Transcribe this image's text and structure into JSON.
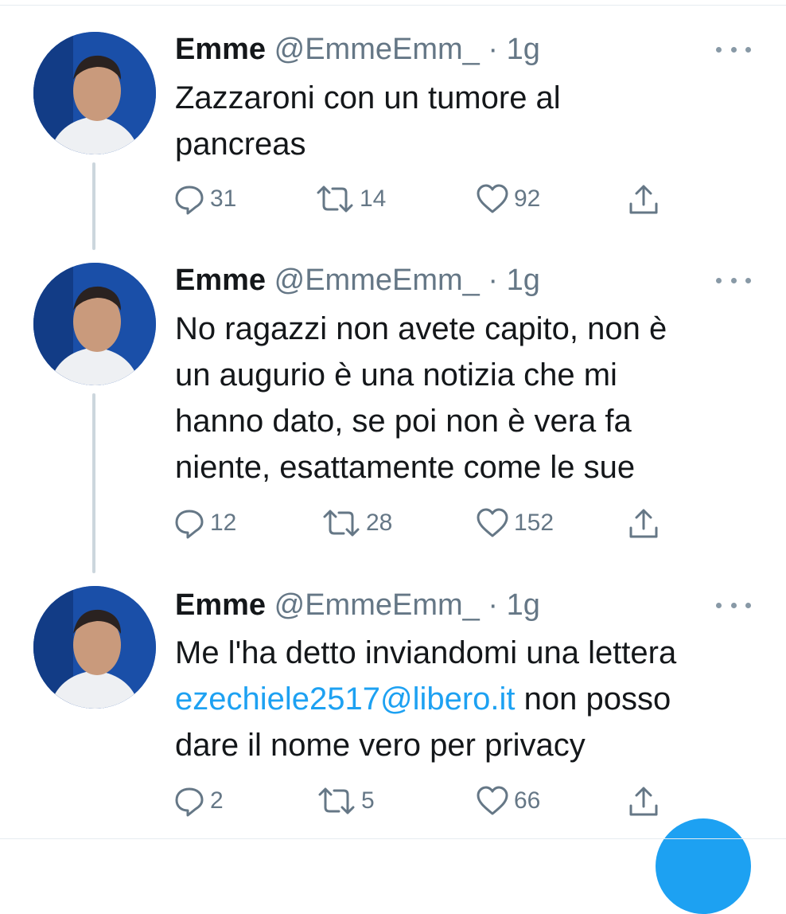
{
  "tweets": [
    {
      "name": "Emme",
      "handle": "@EmmeEmm_",
      "separator": "·",
      "time": "1g",
      "text_lines": [
        "Zazzaroni con un tumore al",
        "pancreas"
      ],
      "replies": "31",
      "retweets": "14",
      "likes": "92"
    },
    {
      "name": "Emme",
      "handle": "@EmmeEmm_",
      "separator": "·",
      "time": "1g",
      "text_lines": [
        "No ragazzi non avete capito, non è",
        "un augurio è una notizia che mi",
        "hanno dato, se poi non è vera fa",
        "niente, esattamente come le sue"
      ],
      "replies": "12",
      "retweets": "28",
      "likes": "152"
    },
    {
      "name": "Emme",
      "handle": "@EmmeEmm_",
      "separator": "·",
      "time": "1g",
      "text_line1": "Me l'ha detto inviandomi una lettera",
      "text_link": "ezechiele2517@libero.it",
      "text_line2_rest": " non posso",
      "text_line3": "dare il nome vero per privacy",
      "replies": "2",
      "retweets": "5",
      "likes": "66"
    }
  ],
  "icons": {
    "reply": "reply-icon",
    "retweet": "retweet-icon",
    "like": "heart-icon",
    "share": "share-icon",
    "more": "more-icon",
    "compose": "compose-fab"
  },
  "colors": {
    "text": "#14171a",
    "secondary": "#657786",
    "link": "#1da1f2",
    "thread_line": "#ccd6dd"
  }
}
